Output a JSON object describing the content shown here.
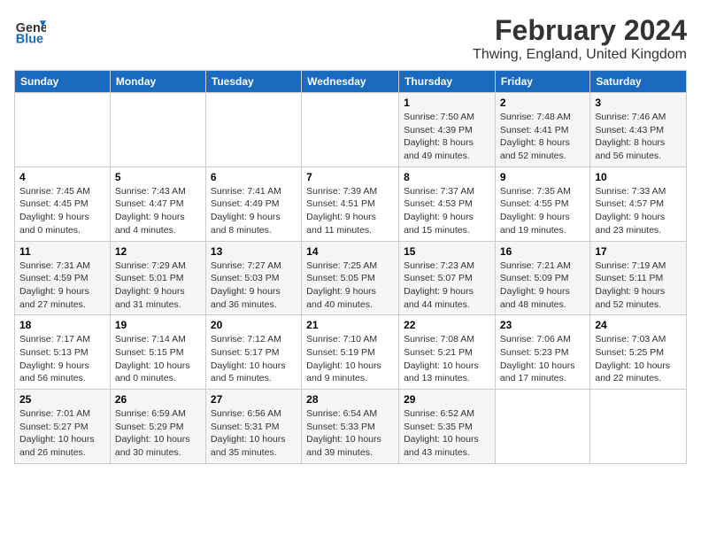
{
  "logo": {
    "line1": "General",
    "line2": "Blue"
  },
  "title": "February 2024",
  "location": "Thwing, England, United Kingdom",
  "days_of_week": [
    "Sunday",
    "Monday",
    "Tuesday",
    "Wednesday",
    "Thursday",
    "Friday",
    "Saturday"
  ],
  "weeks": [
    [
      {
        "day": "",
        "info": ""
      },
      {
        "day": "",
        "info": ""
      },
      {
        "day": "",
        "info": ""
      },
      {
        "day": "",
        "info": ""
      },
      {
        "day": "1",
        "info": "Sunrise: 7:50 AM\nSunset: 4:39 PM\nDaylight: 8 hours\nand 49 minutes."
      },
      {
        "day": "2",
        "info": "Sunrise: 7:48 AM\nSunset: 4:41 PM\nDaylight: 8 hours\nand 52 minutes."
      },
      {
        "day": "3",
        "info": "Sunrise: 7:46 AM\nSunset: 4:43 PM\nDaylight: 8 hours\nand 56 minutes."
      }
    ],
    [
      {
        "day": "4",
        "info": "Sunrise: 7:45 AM\nSunset: 4:45 PM\nDaylight: 9 hours\nand 0 minutes."
      },
      {
        "day": "5",
        "info": "Sunrise: 7:43 AM\nSunset: 4:47 PM\nDaylight: 9 hours\nand 4 minutes."
      },
      {
        "day": "6",
        "info": "Sunrise: 7:41 AM\nSunset: 4:49 PM\nDaylight: 9 hours\nand 8 minutes."
      },
      {
        "day": "7",
        "info": "Sunrise: 7:39 AM\nSunset: 4:51 PM\nDaylight: 9 hours\nand 11 minutes."
      },
      {
        "day": "8",
        "info": "Sunrise: 7:37 AM\nSunset: 4:53 PM\nDaylight: 9 hours\nand 15 minutes."
      },
      {
        "day": "9",
        "info": "Sunrise: 7:35 AM\nSunset: 4:55 PM\nDaylight: 9 hours\nand 19 minutes."
      },
      {
        "day": "10",
        "info": "Sunrise: 7:33 AM\nSunset: 4:57 PM\nDaylight: 9 hours\nand 23 minutes."
      }
    ],
    [
      {
        "day": "11",
        "info": "Sunrise: 7:31 AM\nSunset: 4:59 PM\nDaylight: 9 hours\nand 27 minutes."
      },
      {
        "day": "12",
        "info": "Sunrise: 7:29 AM\nSunset: 5:01 PM\nDaylight: 9 hours\nand 31 minutes."
      },
      {
        "day": "13",
        "info": "Sunrise: 7:27 AM\nSunset: 5:03 PM\nDaylight: 9 hours\nand 36 minutes."
      },
      {
        "day": "14",
        "info": "Sunrise: 7:25 AM\nSunset: 5:05 PM\nDaylight: 9 hours\nand 40 minutes."
      },
      {
        "day": "15",
        "info": "Sunrise: 7:23 AM\nSunset: 5:07 PM\nDaylight: 9 hours\nand 44 minutes."
      },
      {
        "day": "16",
        "info": "Sunrise: 7:21 AM\nSunset: 5:09 PM\nDaylight: 9 hours\nand 48 minutes."
      },
      {
        "day": "17",
        "info": "Sunrise: 7:19 AM\nSunset: 5:11 PM\nDaylight: 9 hours\nand 52 minutes."
      }
    ],
    [
      {
        "day": "18",
        "info": "Sunrise: 7:17 AM\nSunset: 5:13 PM\nDaylight: 9 hours\nand 56 minutes."
      },
      {
        "day": "19",
        "info": "Sunrise: 7:14 AM\nSunset: 5:15 PM\nDaylight: 10 hours\nand 0 minutes."
      },
      {
        "day": "20",
        "info": "Sunrise: 7:12 AM\nSunset: 5:17 PM\nDaylight: 10 hours\nand 5 minutes."
      },
      {
        "day": "21",
        "info": "Sunrise: 7:10 AM\nSunset: 5:19 PM\nDaylight: 10 hours\nand 9 minutes."
      },
      {
        "day": "22",
        "info": "Sunrise: 7:08 AM\nSunset: 5:21 PM\nDaylight: 10 hours\nand 13 minutes."
      },
      {
        "day": "23",
        "info": "Sunrise: 7:06 AM\nSunset: 5:23 PM\nDaylight: 10 hours\nand 17 minutes."
      },
      {
        "day": "24",
        "info": "Sunrise: 7:03 AM\nSunset: 5:25 PM\nDaylight: 10 hours\nand 22 minutes."
      }
    ],
    [
      {
        "day": "25",
        "info": "Sunrise: 7:01 AM\nSunset: 5:27 PM\nDaylight: 10 hours\nand 26 minutes."
      },
      {
        "day": "26",
        "info": "Sunrise: 6:59 AM\nSunset: 5:29 PM\nDaylight: 10 hours\nand 30 minutes."
      },
      {
        "day": "27",
        "info": "Sunrise: 6:56 AM\nSunset: 5:31 PM\nDaylight: 10 hours\nand 35 minutes."
      },
      {
        "day": "28",
        "info": "Sunrise: 6:54 AM\nSunset: 5:33 PM\nDaylight: 10 hours\nand 39 minutes."
      },
      {
        "day": "29",
        "info": "Sunrise: 6:52 AM\nSunset: 5:35 PM\nDaylight: 10 hours\nand 43 minutes."
      },
      {
        "day": "",
        "info": ""
      },
      {
        "day": "",
        "info": ""
      }
    ]
  ]
}
